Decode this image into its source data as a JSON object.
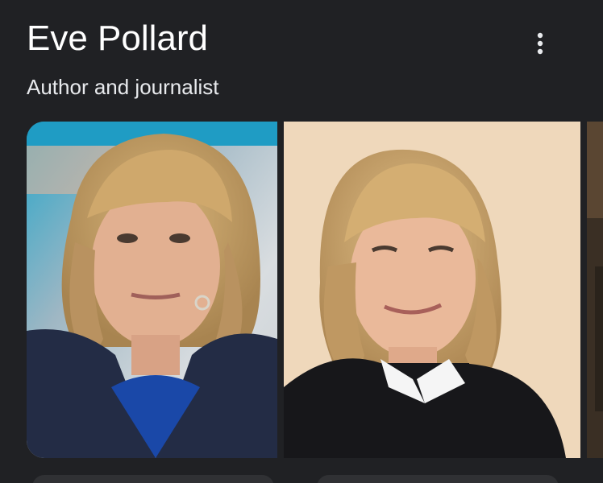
{
  "knowledge_panel": {
    "title": "Eve Pollard",
    "subtitle": "Author and journalist",
    "more_options_icon": "three-dots-vertical-icon"
  },
  "images": [
    {
      "subject": "portrait-photo"
    },
    {
      "subject": "portrait-photo"
    },
    {
      "subject": "portrait-photo"
    }
  ],
  "colors": {
    "background": "#202124",
    "title_text": "#ffffff",
    "subtitle_text": "#e8eaed"
  }
}
